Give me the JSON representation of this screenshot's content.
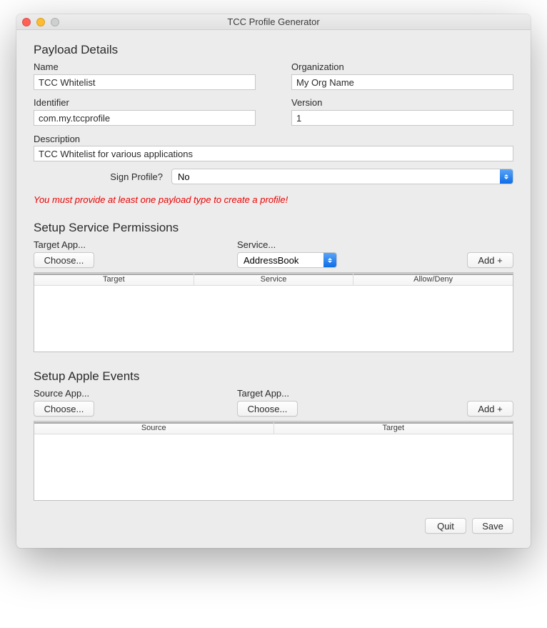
{
  "window": {
    "title": "TCC Profile Generator"
  },
  "payload": {
    "section_title": "Payload Details",
    "name_label": "Name",
    "name_value": "TCC Whitelist",
    "org_label": "Organization",
    "org_value": "My Org Name",
    "identifier_label": "Identifier",
    "identifier_value": "com.my.tccprofile",
    "version_label": "Version",
    "version_value": "1",
    "description_label": "Description",
    "description_value": "TCC Whitelist for various applications",
    "sign_label": "Sign Profile?",
    "sign_value": "No"
  },
  "error_message": "You must provide at least one payload type to create a profile!",
  "permissions": {
    "section_title": "Setup Service Permissions",
    "target_label": "Target App...",
    "choose_label": "Choose...",
    "service_label": "Service...",
    "service_value": "AddressBook",
    "add_label": "Add +",
    "columns": {
      "target": "Target",
      "service": "Service",
      "allow_deny": "Allow/Deny"
    }
  },
  "events": {
    "section_title": "Setup Apple Events",
    "source_label": "Source App...",
    "target_label": "Target App...",
    "choose_label": "Choose...",
    "add_label": "Add +",
    "columns": {
      "source": "Source",
      "target": "Target"
    }
  },
  "footer": {
    "quit": "Quit",
    "save": "Save"
  }
}
